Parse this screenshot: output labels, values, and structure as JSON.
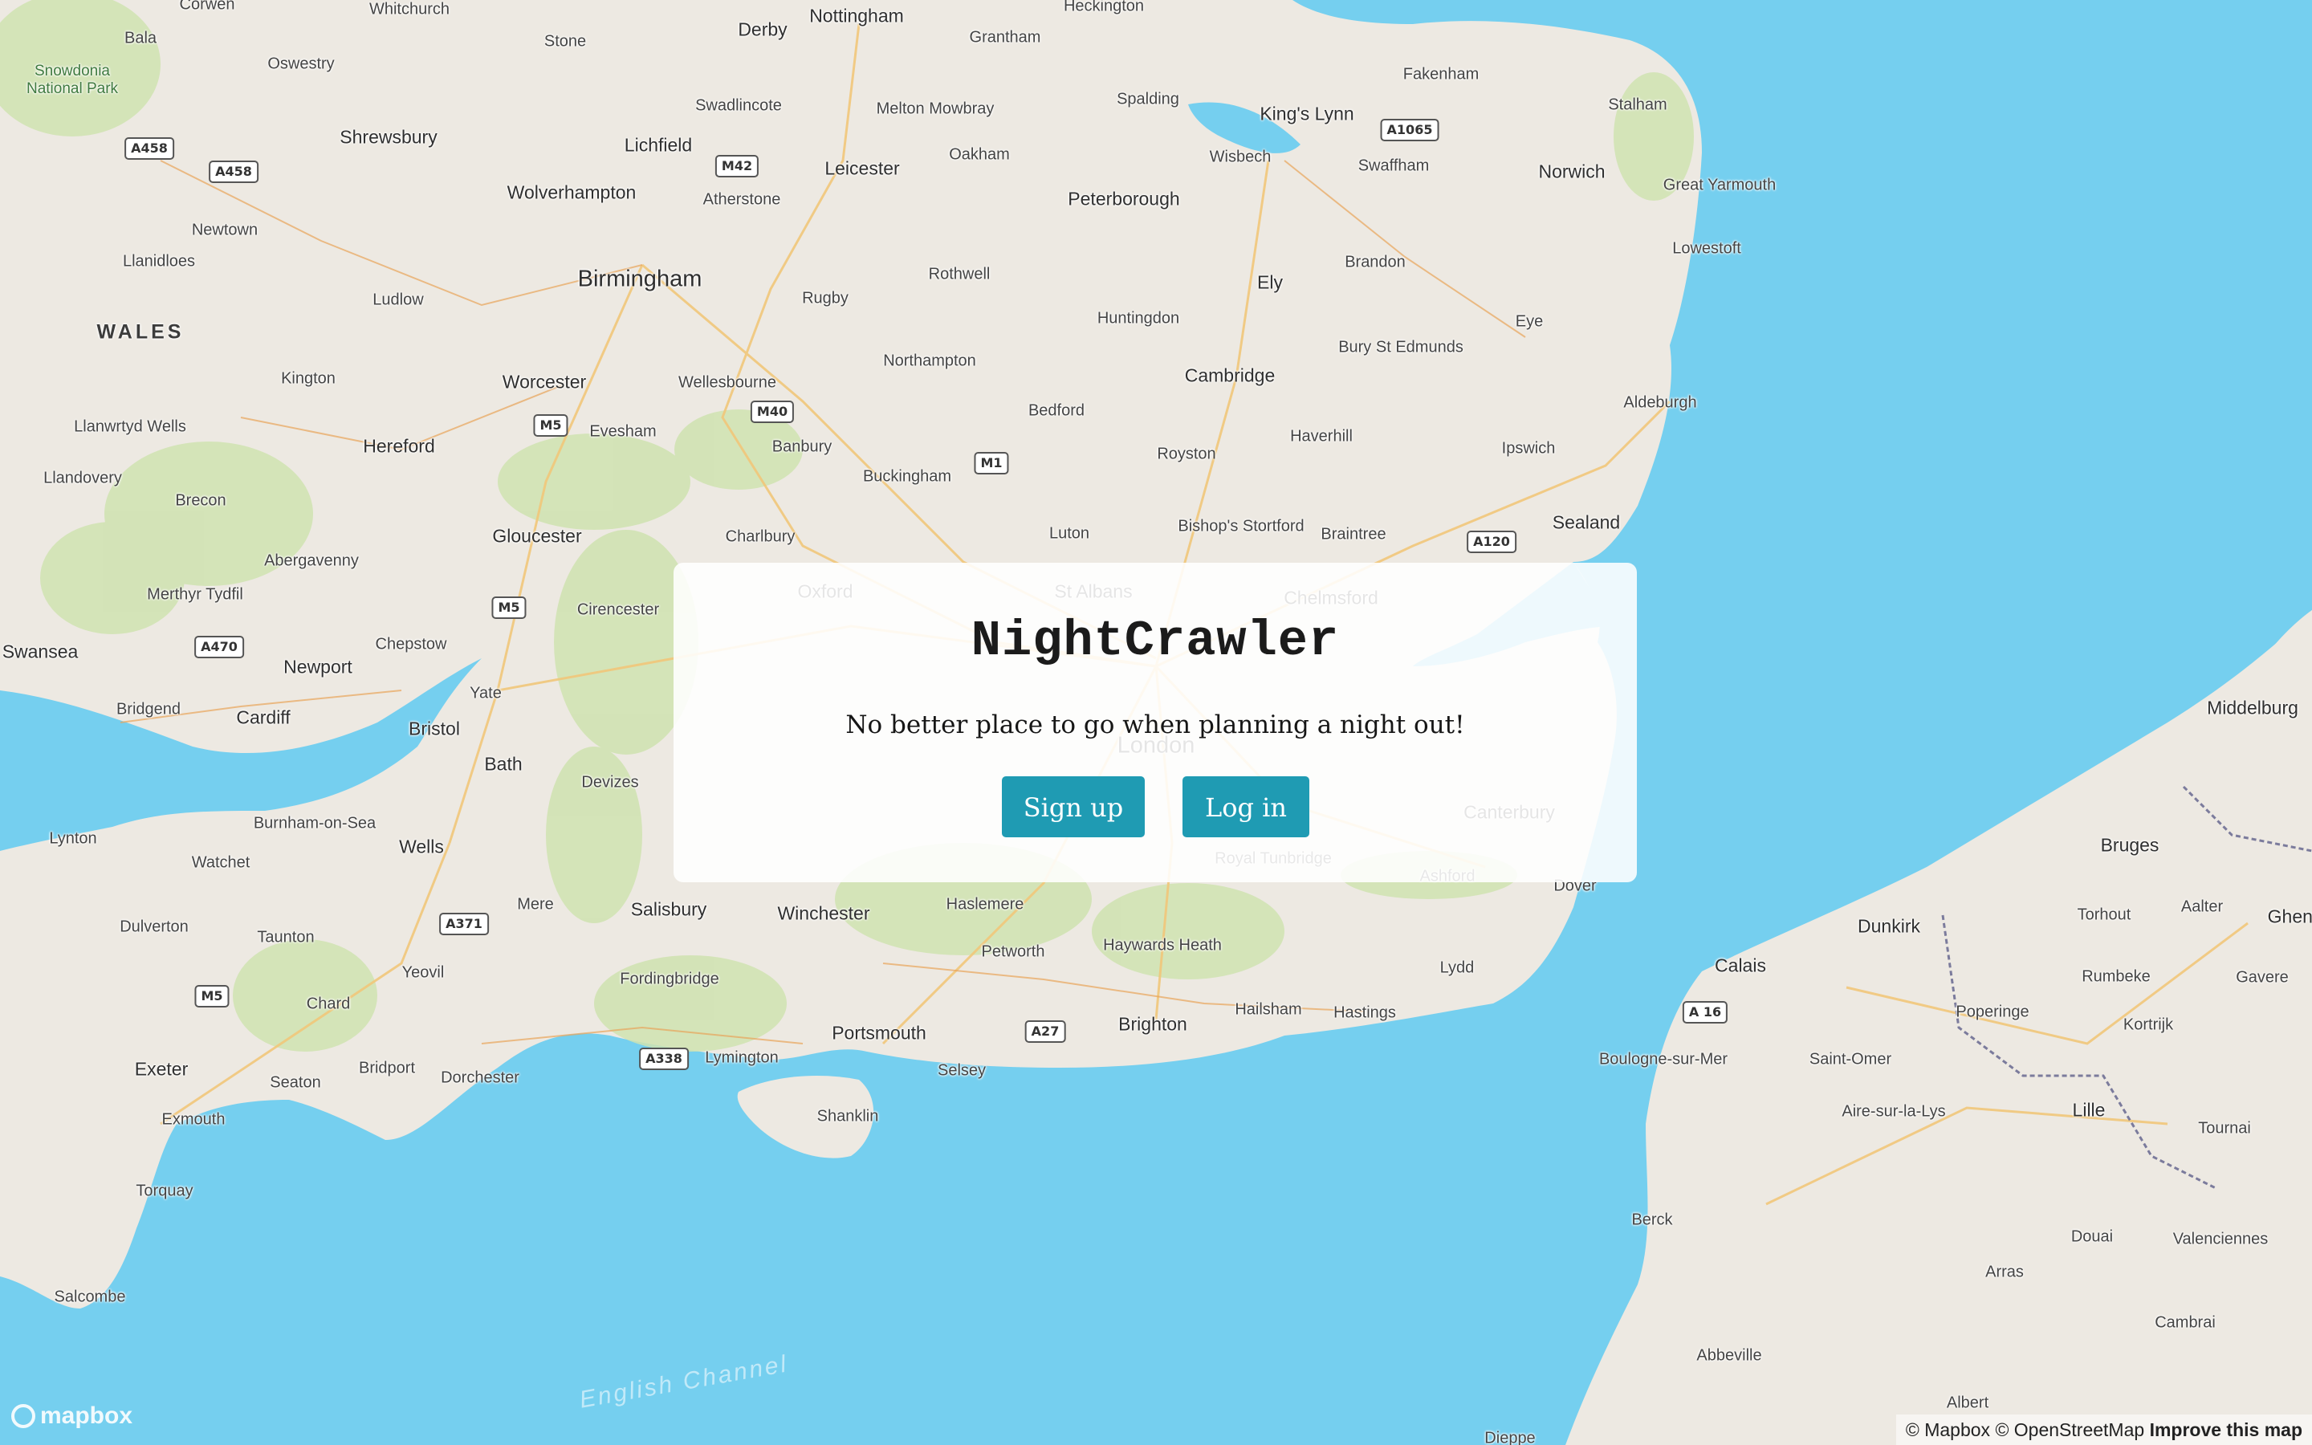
{
  "app": {
    "title": "NightCrawler",
    "tagline": "No better place to go when planning a night out!",
    "signup_label": "Sign up",
    "login_label": "Log in",
    "accent_color": "#1f9bb3"
  },
  "map": {
    "water_label": "English Channel",
    "attribution": {
      "logo_text": "mapbox",
      "mapbox": "© Mapbox",
      "osm": "© OpenStreetMap",
      "improve": "Improve this map"
    },
    "places": [
      {
        "name": "Nottingham",
        "cls": "c2"
      },
      {
        "name": "Derby",
        "cls": "c2"
      },
      {
        "name": "Grantham",
        "cls": "c3"
      },
      {
        "name": "Heckington",
        "cls": "c3"
      },
      {
        "name": "Whitchurch",
        "cls": "c3"
      },
      {
        "name": "Corwen",
        "cls": "c3"
      },
      {
        "name": "Bala",
        "cls": "c3"
      },
      {
        "name": "Stone",
        "cls": "c3"
      },
      {
        "name": "Oswestry",
        "cls": "c3"
      },
      {
        "name": "Swadlincote",
        "cls": "c3"
      },
      {
        "name": "Melton Mowbray",
        "cls": "c3"
      },
      {
        "name": "Spalding",
        "cls": "c3"
      },
      {
        "name": "King's Lynn",
        "cls": "c2"
      },
      {
        "name": "Fakenham",
        "cls": "c3"
      },
      {
        "name": "Stalham",
        "cls": "c3"
      },
      {
        "name": "Lichfield",
        "cls": "c2"
      },
      {
        "name": "Shrewsbury",
        "cls": "c2"
      },
      {
        "name": "Oakham",
        "cls": "c3"
      },
      {
        "name": "Wisbech",
        "cls": "c3"
      },
      {
        "name": "Swaffham",
        "cls": "c3"
      },
      {
        "name": "Norwich",
        "cls": "c2"
      },
      {
        "name": "Leicester",
        "cls": "c2"
      },
      {
        "name": "Wolverhampton",
        "cls": "c2"
      },
      {
        "name": "Atherstone",
        "cls": "c3"
      },
      {
        "name": "Peterborough",
        "cls": "c2"
      },
      {
        "name": "Great Yarmouth",
        "cls": "c3"
      },
      {
        "name": "Newtown",
        "cls": "c3"
      },
      {
        "name": "Lowestoft",
        "cls": "c3"
      },
      {
        "name": "Llanidloes",
        "cls": "c3"
      },
      {
        "name": "Rothwell",
        "cls": "c3"
      },
      {
        "name": "Brandon",
        "cls": "c3"
      },
      {
        "name": "Birmingham",
        "cls": "c1"
      },
      {
        "name": "Ely",
        "cls": "c2"
      },
      {
        "name": "Ludlow",
        "cls": "c3"
      },
      {
        "name": "Rugby",
        "cls": "c3"
      },
      {
        "name": "WALES",
        "cls": "region"
      },
      {
        "name": "Huntingdon",
        "cls": "c3"
      },
      {
        "name": "Eye",
        "cls": "c3"
      },
      {
        "name": "Bury St Edmunds",
        "cls": "c3"
      },
      {
        "name": "Northampton",
        "cls": "c3"
      },
      {
        "name": "Kington",
        "cls": "c3"
      },
      {
        "name": "Worcester",
        "cls": "c2"
      },
      {
        "name": "Wellesbourne",
        "cls": "c3"
      },
      {
        "name": "Cambridge",
        "cls": "c2"
      },
      {
        "name": "Aldeburgh",
        "cls": "c3"
      },
      {
        "name": "Bedford",
        "cls": "c3"
      },
      {
        "name": "Llanwrtyd Wells",
        "cls": "c3"
      },
      {
        "name": "Evesham",
        "cls": "c3"
      },
      {
        "name": "Haverhill",
        "cls": "c3"
      },
      {
        "name": "Hereford",
        "cls": "c2"
      },
      {
        "name": "Banbury",
        "cls": "c3"
      },
      {
        "name": "Ipswich",
        "cls": "c3"
      },
      {
        "name": "Royston",
        "cls": "c3"
      },
      {
        "name": "Buckingham",
        "cls": "c3"
      },
      {
        "name": "Llandovery",
        "cls": "c3"
      },
      {
        "name": "Brecon",
        "cls": "c3"
      },
      {
        "name": "Bishop's Stortford",
        "cls": "c3"
      },
      {
        "name": "Sealand",
        "cls": "c2"
      },
      {
        "name": "Luton",
        "cls": "c3"
      },
      {
        "name": "Gloucester",
        "cls": "c2"
      },
      {
        "name": "Charlbury",
        "cls": "c3"
      },
      {
        "name": "Braintree",
        "cls": "c3"
      },
      {
        "name": "Abergavenny",
        "cls": "c3"
      },
      {
        "name": "Merthyr Tydfil",
        "cls": "c3"
      },
      {
        "name": "Cirencester",
        "cls": "c3"
      },
      {
        "name": "Swansea",
        "cls": "c2"
      },
      {
        "name": "Chepstow",
        "cls": "c3"
      },
      {
        "name": "Newport",
        "cls": "c2"
      },
      {
        "name": "Middelburg",
        "cls": "c2"
      },
      {
        "name": "Yate",
        "cls": "c3"
      },
      {
        "name": "Bridgend",
        "cls": "c3"
      },
      {
        "name": "Cardiff",
        "cls": "c2"
      },
      {
        "name": "Bristol",
        "cls": "c2"
      },
      {
        "name": "Bath",
        "cls": "c2"
      },
      {
        "name": "Devizes",
        "cls": "c3"
      },
      {
        "name": "Burnham-on-Sea",
        "cls": "c3"
      },
      {
        "name": "Lynton",
        "cls": "c3"
      },
      {
        "name": "Watchet",
        "cls": "c3"
      },
      {
        "name": "Wells",
        "cls": "c2"
      },
      {
        "name": "Bruges",
        "cls": "c2"
      },
      {
        "name": "Mere",
        "cls": "c3"
      },
      {
        "name": "Salisbury",
        "cls": "c2"
      },
      {
        "name": "Winchester",
        "cls": "c2"
      },
      {
        "name": "Haslemere",
        "cls": "c3"
      },
      {
        "name": "Dover",
        "cls": "c3"
      },
      {
        "name": "Aalter",
        "cls": "c3"
      },
      {
        "name": "Ghent",
        "cls": "c2"
      },
      {
        "name": "Torhout",
        "cls": "c3"
      },
      {
        "name": "Dulverton",
        "cls": "c3"
      },
      {
        "name": "Taunton",
        "cls": "c3"
      },
      {
        "name": "Dunkirk",
        "cls": "c2"
      },
      {
        "name": "Haywards Heath",
        "cls": "c3"
      },
      {
        "name": "Petworth",
        "cls": "c3"
      },
      {
        "name": "Calais",
        "cls": "c2"
      },
      {
        "name": "Lydd",
        "cls": "c3"
      },
      {
        "name": "Yeovil",
        "cls": "c3"
      },
      {
        "name": "Rumbeke",
        "cls": "c3"
      },
      {
        "name": "Gavere",
        "cls": "c3"
      },
      {
        "name": "Fordingbridge",
        "cls": "c3"
      },
      {
        "name": "Chard",
        "cls": "c3"
      },
      {
        "name": "Hailsham",
        "cls": "c3"
      },
      {
        "name": "Hastings",
        "cls": "c3"
      },
      {
        "name": "Poperinge",
        "cls": "c3"
      },
      {
        "name": "Kortrijk",
        "cls": "c3"
      },
      {
        "name": "Brighton",
        "cls": "c2"
      },
      {
        "name": "Portsmouth",
        "cls": "c2"
      },
      {
        "name": "Boulogne-sur-Mer",
        "cls": "c3"
      },
      {
        "name": "Saint-Omer",
        "cls": "c3"
      },
      {
        "name": "Lymington",
        "cls": "c3"
      },
      {
        "name": "Exeter",
        "cls": "c2"
      },
      {
        "name": "Bridport",
        "cls": "c3"
      },
      {
        "name": "Selsey",
        "cls": "c3"
      },
      {
        "name": "Dorchester",
        "cls": "c3"
      },
      {
        "name": "Seaton",
        "cls": "c3"
      },
      {
        "name": "Lille",
        "cls": "c2"
      },
      {
        "name": "Aire-sur-la-Lys",
        "cls": "c3"
      },
      {
        "name": "Exmouth",
        "cls": "c3"
      },
      {
        "name": "Shanklin",
        "cls": "c3"
      },
      {
        "name": "Tournai",
        "cls": "c3"
      },
      {
        "name": "Torquay",
        "cls": "c3"
      },
      {
        "name": "Berck",
        "cls": "c3"
      },
      {
        "name": "Douai",
        "cls": "c3"
      },
      {
        "name": "Valenciennes",
        "cls": "c3"
      },
      {
        "name": "Arras",
        "cls": "c3"
      },
      {
        "name": "Salcombe",
        "cls": "c3"
      },
      {
        "name": "Cambrai",
        "cls": "c3"
      },
      {
        "name": "Abbeville",
        "cls": "c3"
      },
      {
        "name": "Albert",
        "cls": "c3"
      },
      {
        "name": "Dieppe",
        "cls": "c3"
      },
      {
        "name": "Snowdonia National Park",
        "cls": "park"
      },
      {
        "name": "Oxford",
        "cls": "c2"
      },
      {
        "name": "St Albans",
        "cls": "c2"
      },
      {
        "name": "Chelmsford",
        "cls": "c2"
      },
      {
        "name": "London",
        "cls": "c1"
      },
      {
        "name": "Canterbury",
        "cls": "c2"
      },
      {
        "name": "Royal Tunbridge",
        "cls": "c3"
      },
      {
        "name": "Ashford",
        "cls": "c3"
      }
    ],
    "roads": [
      "M42",
      "A1065",
      "A458",
      "A458",
      "M40",
      "M5",
      "M1",
      "A120",
      "M5",
      "A470",
      "A371",
      "M5",
      "A338",
      "A27",
      "A 16"
    ]
  }
}
